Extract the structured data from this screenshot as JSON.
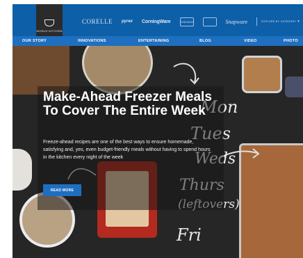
{
  "logo": {
    "text": "WORLD KITCHEN"
  },
  "brands": [
    "CORELLE",
    "pyrex",
    "CorningWare",
    "CHICAGO",
    "Snapware"
  ],
  "explore": {
    "label": "EXPLORE BY CATEGORY"
  },
  "nav": {
    "items": [
      "OUR STORY",
      "INNOVATIONS",
      "ENTERTAINING",
      "BLOG",
      "VIDEO",
      "PHOTO"
    ]
  },
  "hero": {
    "headline": "Make-Ahead Freezer Meals To Cover The Entire Week",
    "description": "Freeze-ahead recipes are one of the best ways to ensure homemade, satisfying and, yes, even budget-friendly meals without having to spend hours in the kitchen every night of the week",
    "cta": "READ MORE",
    "chalk_days": [
      "Mon",
      "Tues",
      "Weds",
      "Thurs",
      "(leftovers)",
      "Fri"
    ]
  },
  "colors": {
    "brand_bar": "#0d5fa8",
    "nav_bar": "#1f6fc0",
    "cta": "#1f6fc0",
    "chalkboard": "#262626"
  }
}
